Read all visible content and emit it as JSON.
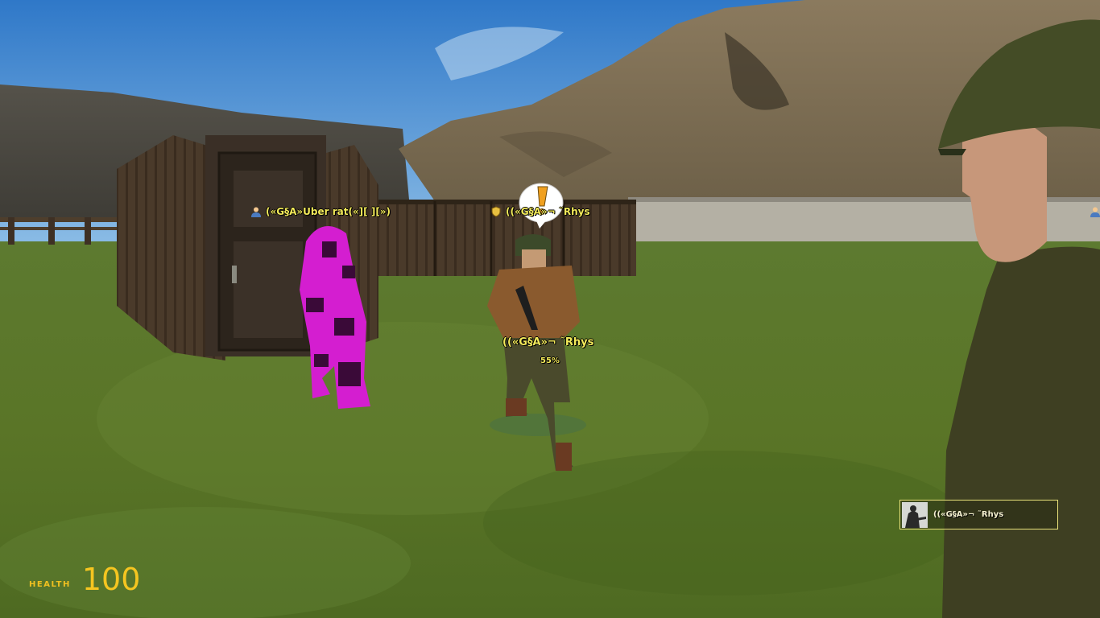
{
  "hud": {
    "health_label": "HEALTH",
    "health_value": "100"
  },
  "nametags": {
    "player1": "(«G§A»Uber rat(«][ ][»)",
    "player2": "((«G§A»¬ ˜Rhys"
  },
  "target": {
    "name": "((«G§A»¬ ˜Rhys",
    "health_percent": "55%"
  },
  "voice_chat": {
    "speaker": "((«G§A»¬ ˜Rhys"
  },
  "colors": {
    "tag_text": "#f3ea5a",
    "hud_accent": "#f5c520",
    "voice_border": "#e9e27a"
  },
  "icons": {
    "player1_icon": "user-icon",
    "player2_icon": "shield-icon",
    "speech_bubble": "exclamation-bubble-icon",
    "offscreen_player": "user-icon"
  }
}
